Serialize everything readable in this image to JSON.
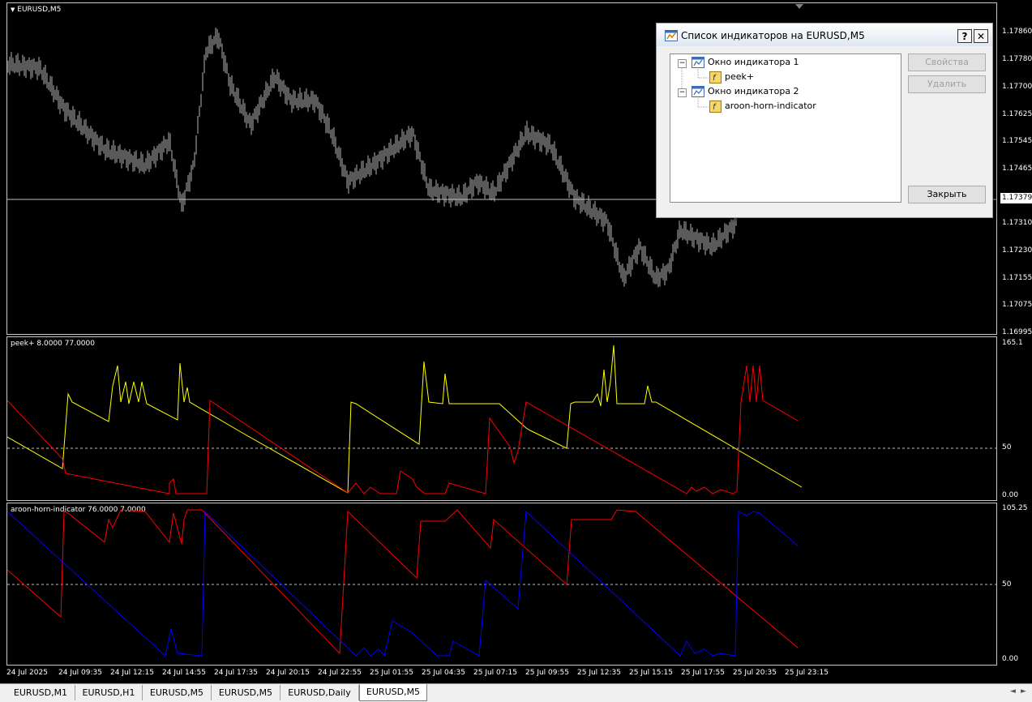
{
  "window": {
    "symbol_label": "EURUSD,M5",
    "current_price": "1.17379"
  },
  "main_pane": {
    "price_scale": [
      "1.17860",
      "1.17780",
      "1.17700",
      "1.17625",
      "1.17545",
      "1.17465",
      "1.17310",
      "1.17230",
      "1.17155",
      "1.17075",
      "1.16995"
    ]
  },
  "peek_pane": {
    "label": "peek+ 8.0000 77.0000",
    "scale_top": "165.1",
    "scale_mid": "50",
    "scale_bottom": "0.00"
  },
  "aroon_pane": {
    "label": "aroon-horn-indicator 76.0000 7.0000",
    "scale_top": "105.25",
    "scale_mid": "50",
    "scale_bottom": "0.00"
  },
  "time_axis": [
    "24 Jul 2025",
    "24 Jul 09:35",
    "24 Jul 12:15",
    "24 Jul 14:55",
    "24 Jul 17:35",
    "24 Jul 20:15",
    "24 Jul 22:55",
    "25 Jul 01:55",
    "25 Jul 04:35",
    "25 Jul 07:15",
    "25 Jul 09:55",
    "25 Jul 12:35",
    "25 Jul 15:15",
    "25 Jul 17:55",
    "25 Jul 20:35",
    "25 Jul 23:15"
  ],
  "tabs": [
    "EURUSD,M1",
    "EURUSD,H1",
    "EURUSD,M5",
    "EURUSD,M5",
    "EURUSD,Daily",
    "EURUSD,M5"
  ],
  "dialog": {
    "title": "Список индикаторов на EURUSD,M5",
    "help_label": "?",
    "close_label": "✕",
    "tree": {
      "window1": "Окно индикатора 1",
      "item1": "peek+",
      "window2": "Окно индикатора 2",
      "item2": "aroon-horn-indicator"
    },
    "buttons": {
      "properties": "Свойства",
      "delete": "Удалить",
      "close": "Закрыть"
    }
  },
  "colors": {
    "background": "#000000",
    "candles": "#b4b4b4",
    "peek_line_1": "#ffff00",
    "peek_line_2": "#ff0000",
    "aroon_up": "#ff0000",
    "aroon_down": "#0000ff"
  }
}
